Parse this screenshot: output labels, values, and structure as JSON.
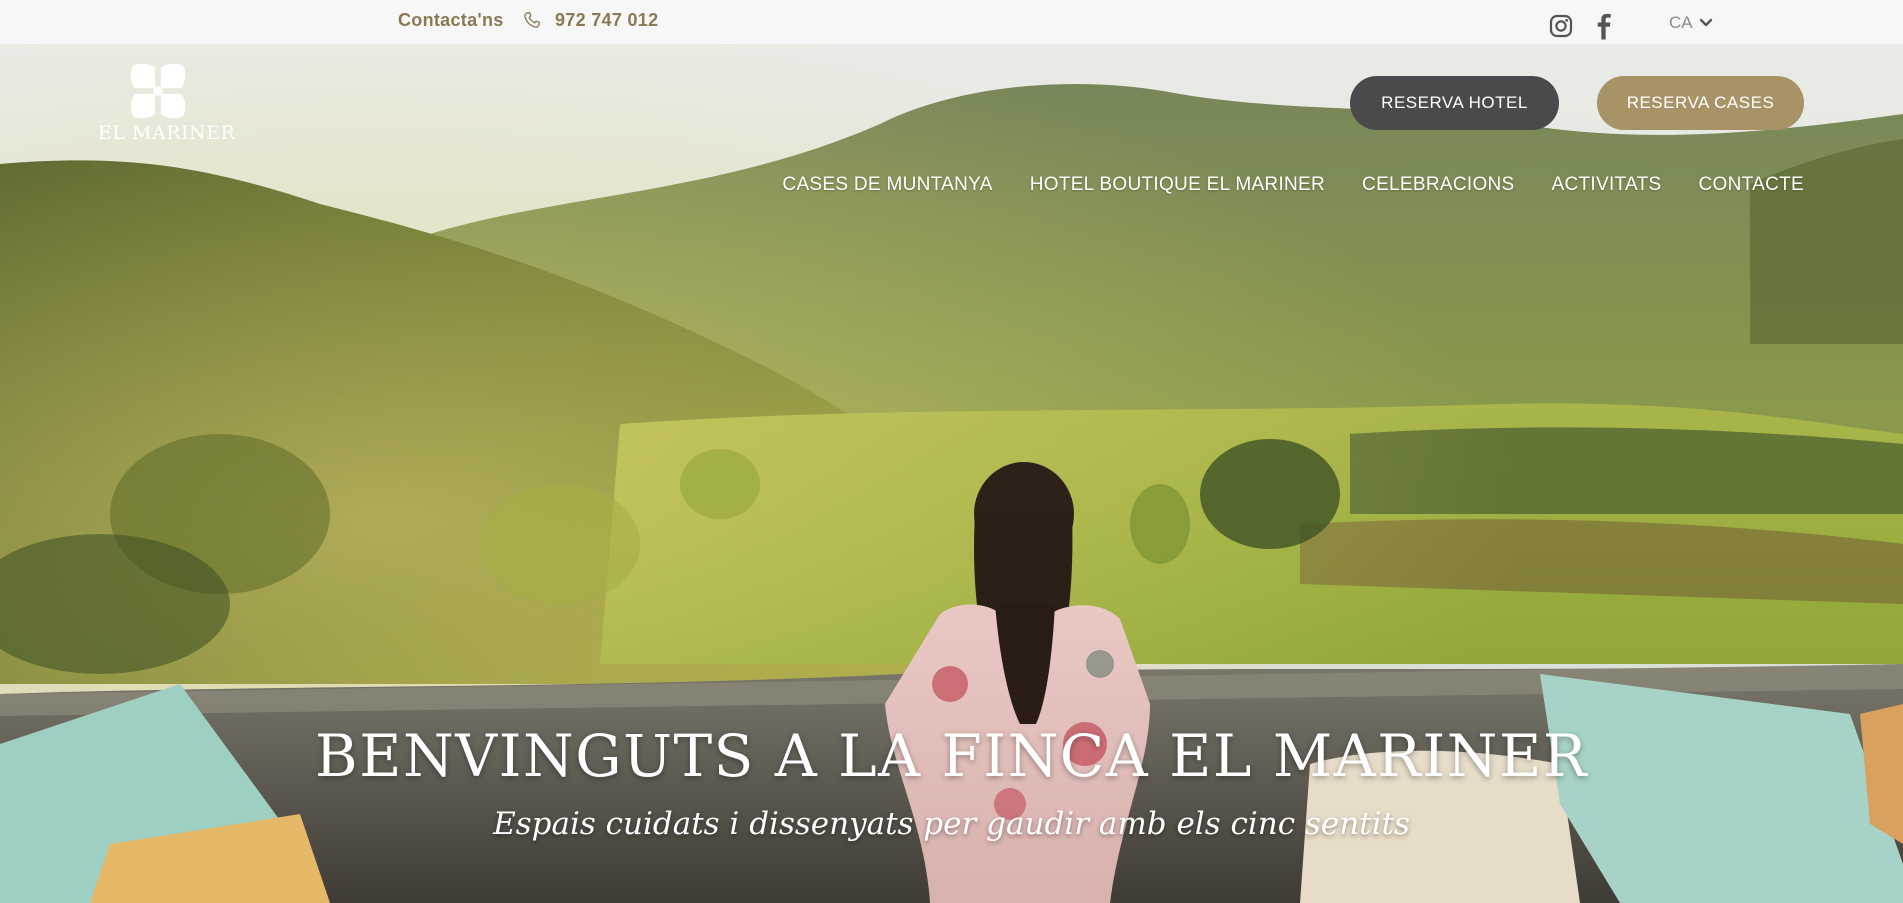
{
  "topbar": {
    "contact_label": "Contacta'ns",
    "phone": "972 747 012",
    "language": "CA"
  },
  "logo": {
    "text": "EL MARINER"
  },
  "buttons": {
    "hotel": "RESERVA HOTEL",
    "cases": "RESERVA CASES"
  },
  "nav": {
    "items": [
      {
        "label": "CASES DE MUNTANYA"
      },
      {
        "label": "HOTEL BOUTIQUE EL MARINER"
      },
      {
        "label": "CELEBRACIONS"
      },
      {
        "label": "ACTIVITATS"
      },
      {
        "label": "CONTACTE"
      }
    ]
  },
  "hero": {
    "title": "BENVINGUTS A LA FINCA EL MARINER",
    "subtitle": "Espais cuidats i dissenyats per gaudir amb els cinc sentits"
  },
  "colors": {
    "accent_gold": "#a89366",
    "dark_button": "#4a4a4c",
    "contact_text": "#8a7a52",
    "topbar_bg": "#f7f7f7"
  },
  "icons": [
    "phone-icon",
    "instagram-icon",
    "facebook-icon",
    "chevron-down-icon",
    "logo-flower-icon"
  ]
}
